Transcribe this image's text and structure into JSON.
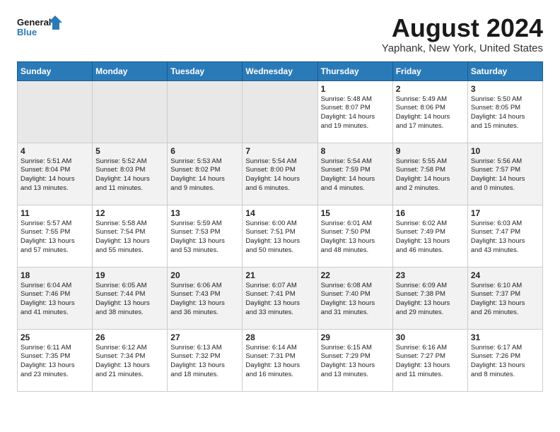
{
  "header": {
    "logo_line1": "General",
    "logo_line2": "Blue",
    "month_title": "August 2024",
    "location": "Yaphank, New York, United States"
  },
  "weekdays": [
    "Sunday",
    "Monday",
    "Tuesday",
    "Wednesday",
    "Thursday",
    "Friday",
    "Saturday"
  ],
  "weeks": [
    [
      {
        "day": "",
        "info": ""
      },
      {
        "day": "",
        "info": ""
      },
      {
        "day": "",
        "info": ""
      },
      {
        "day": "",
        "info": ""
      },
      {
        "day": "1",
        "info": "Sunrise: 5:48 AM\nSunset: 8:07 PM\nDaylight: 14 hours\nand 19 minutes."
      },
      {
        "day": "2",
        "info": "Sunrise: 5:49 AM\nSunset: 8:06 PM\nDaylight: 14 hours\nand 17 minutes."
      },
      {
        "day": "3",
        "info": "Sunrise: 5:50 AM\nSunset: 8:05 PM\nDaylight: 14 hours\nand 15 minutes."
      }
    ],
    [
      {
        "day": "4",
        "info": "Sunrise: 5:51 AM\nSunset: 8:04 PM\nDaylight: 14 hours\nand 13 minutes."
      },
      {
        "day": "5",
        "info": "Sunrise: 5:52 AM\nSunset: 8:03 PM\nDaylight: 14 hours\nand 11 minutes."
      },
      {
        "day": "6",
        "info": "Sunrise: 5:53 AM\nSunset: 8:02 PM\nDaylight: 14 hours\nand 9 minutes."
      },
      {
        "day": "7",
        "info": "Sunrise: 5:54 AM\nSunset: 8:00 PM\nDaylight: 14 hours\nand 6 minutes."
      },
      {
        "day": "8",
        "info": "Sunrise: 5:54 AM\nSunset: 7:59 PM\nDaylight: 14 hours\nand 4 minutes."
      },
      {
        "day": "9",
        "info": "Sunrise: 5:55 AM\nSunset: 7:58 PM\nDaylight: 14 hours\nand 2 minutes."
      },
      {
        "day": "10",
        "info": "Sunrise: 5:56 AM\nSunset: 7:57 PM\nDaylight: 14 hours\nand 0 minutes."
      }
    ],
    [
      {
        "day": "11",
        "info": "Sunrise: 5:57 AM\nSunset: 7:55 PM\nDaylight: 13 hours\nand 57 minutes."
      },
      {
        "day": "12",
        "info": "Sunrise: 5:58 AM\nSunset: 7:54 PM\nDaylight: 13 hours\nand 55 minutes."
      },
      {
        "day": "13",
        "info": "Sunrise: 5:59 AM\nSunset: 7:53 PM\nDaylight: 13 hours\nand 53 minutes."
      },
      {
        "day": "14",
        "info": "Sunrise: 6:00 AM\nSunset: 7:51 PM\nDaylight: 13 hours\nand 50 minutes."
      },
      {
        "day": "15",
        "info": "Sunrise: 6:01 AM\nSunset: 7:50 PM\nDaylight: 13 hours\nand 48 minutes."
      },
      {
        "day": "16",
        "info": "Sunrise: 6:02 AM\nSunset: 7:49 PM\nDaylight: 13 hours\nand 46 minutes."
      },
      {
        "day": "17",
        "info": "Sunrise: 6:03 AM\nSunset: 7:47 PM\nDaylight: 13 hours\nand 43 minutes."
      }
    ],
    [
      {
        "day": "18",
        "info": "Sunrise: 6:04 AM\nSunset: 7:46 PM\nDaylight: 13 hours\nand 41 minutes."
      },
      {
        "day": "19",
        "info": "Sunrise: 6:05 AM\nSunset: 7:44 PM\nDaylight: 13 hours\nand 38 minutes."
      },
      {
        "day": "20",
        "info": "Sunrise: 6:06 AM\nSunset: 7:43 PM\nDaylight: 13 hours\nand 36 minutes."
      },
      {
        "day": "21",
        "info": "Sunrise: 6:07 AM\nSunset: 7:41 PM\nDaylight: 13 hours\nand 33 minutes."
      },
      {
        "day": "22",
        "info": "Sunrise: 6:08 AM\nSunset: 7:40 PM\nDaylight: 13 hours\nand 31 minutes."
      },
      {
        "day": "23",
        "info": "Sunrise: 6:09 AM\nSunset: 7:38 PM\nDaylight: 13 hours\nand 29 minutes."
      },
      {
        "day": "24",
        "info": "Sunrise: 6:10 AM\nSunset: 7:37 PM\nDaylight: 13 hours\nand 26 minutes."
      }
    ],
    [
      {
        "day": "25",
        "info": "Sunrise: 6:11 AM\nSunset: 7:35 PM\nDaylight: 13 hours\nand 23 minutes."
      },
      {
        "day": "26",
        "info": "Sunrise: 6:12 AM\nSunset: 7:34 PM\nDaylight: 13 hours\nand 21 minutes."
      },
      {
        "day": "27",
        "info": "Sunrise: 6:13 AM\nSunset: 7:32 PM\nDaylight: 13 hours\nand 18 minutes."
      },
      {
        "day": "28",
        "info": "Sunrise: 6:14 AM\nSunset: 7:31 PM\nDaylight: 13 hours\nand 16 minutes."
      },
      {
        "day": "29",
        "info": "Sunrise: 6:15 AM\nSunset: 7:29 PM\nDaylight: 13 hours\nand 13 minutes."
      },
      {
        "day": "30",
        "info": "Sunrise: 6:16 AM\nSunset: 7:27 PM\nDaylight: 13 hours\nand 11 minutes."
      },
      {
        "day": "31",
        "info": "Sunrise: 6:17 AM\nSunset: 7:26 PM\nDaylight: 13 hours\nand 8 minutes."
      }
    ]
  ]
}
